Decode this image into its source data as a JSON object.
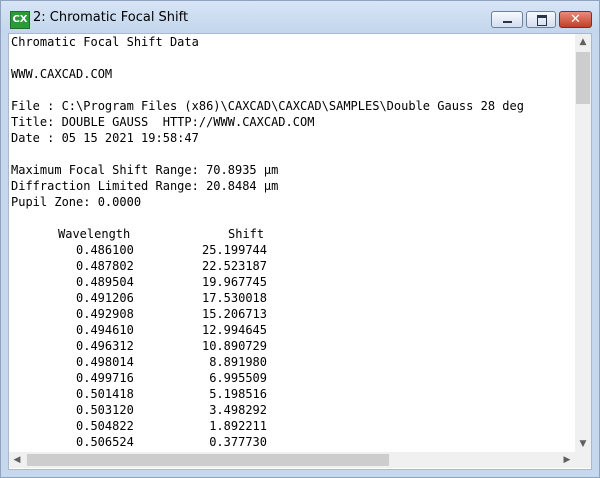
{
  "window": {
    "title": "2: Chromatic Focal Shift",
    "icon_label": "CX",
    "controls": {
      "minimize": "minimize",
      "maximize": "maximize",
      "close": "✕"
    }
  },
  "report": {
    "heading": "Chromatic Focal Shift Data",
    "website": "WWW.CAXCAD.COM",
    "file_line": "File : C:\\Program Files (x86)\\CAXCAD\\CAXCAD\\SAMPLES\\Double Gauss 28 deg",
    "title_line": "Title: DOUBLE GAUSS  HTTP://WWW.CAXCAD.COM",
    "date_line": "Date : 05 15 2021 19:58:47",
    "max_shift_line": "Maximum Focal Shift Range: 70.8935 µm",
    "diffraction_line": "Diffraction Limited Range: 20.8484 µm",
    "pupil_line": "Pupil Zone: 0.0000",
    "table": {
      "headers": [
        "Wavelength",
        "Shift"
      ],
      "rows": [
        [
          "0.486100",
          "25.199744"
        ],
        [
          "0.487802",
          "22.523187"
        ],
        [
          "0.489504",
          "19.967745"
        ],
        [
          "0.491206",
          "17.530018"
        ],
        [
          "0.492908",
          "15.206713"
        ],
        [
          "0.494610",
          "12.994645"
        ],
        [
          "0.496312",
          "10.890729"
        ],
        [
          "0.498014",
          "8.891980"
        ],
        [
          "0.499716",
          "6.995509"
        ],
        [
          "0.501418",
          "5.198516"
        ],
        [
          "0.503120",
          "3.498292"
        ],
        [
          "0.504822",
          "1.892211"
        ],
        [
          "0.506524",
          "0.377730"
        ]
      ]
    }
  },
  "scrollbars": {
    "up": "▲",
    "down": "▼",
    "left": "◀",
    "right": "▶"
  }
}
